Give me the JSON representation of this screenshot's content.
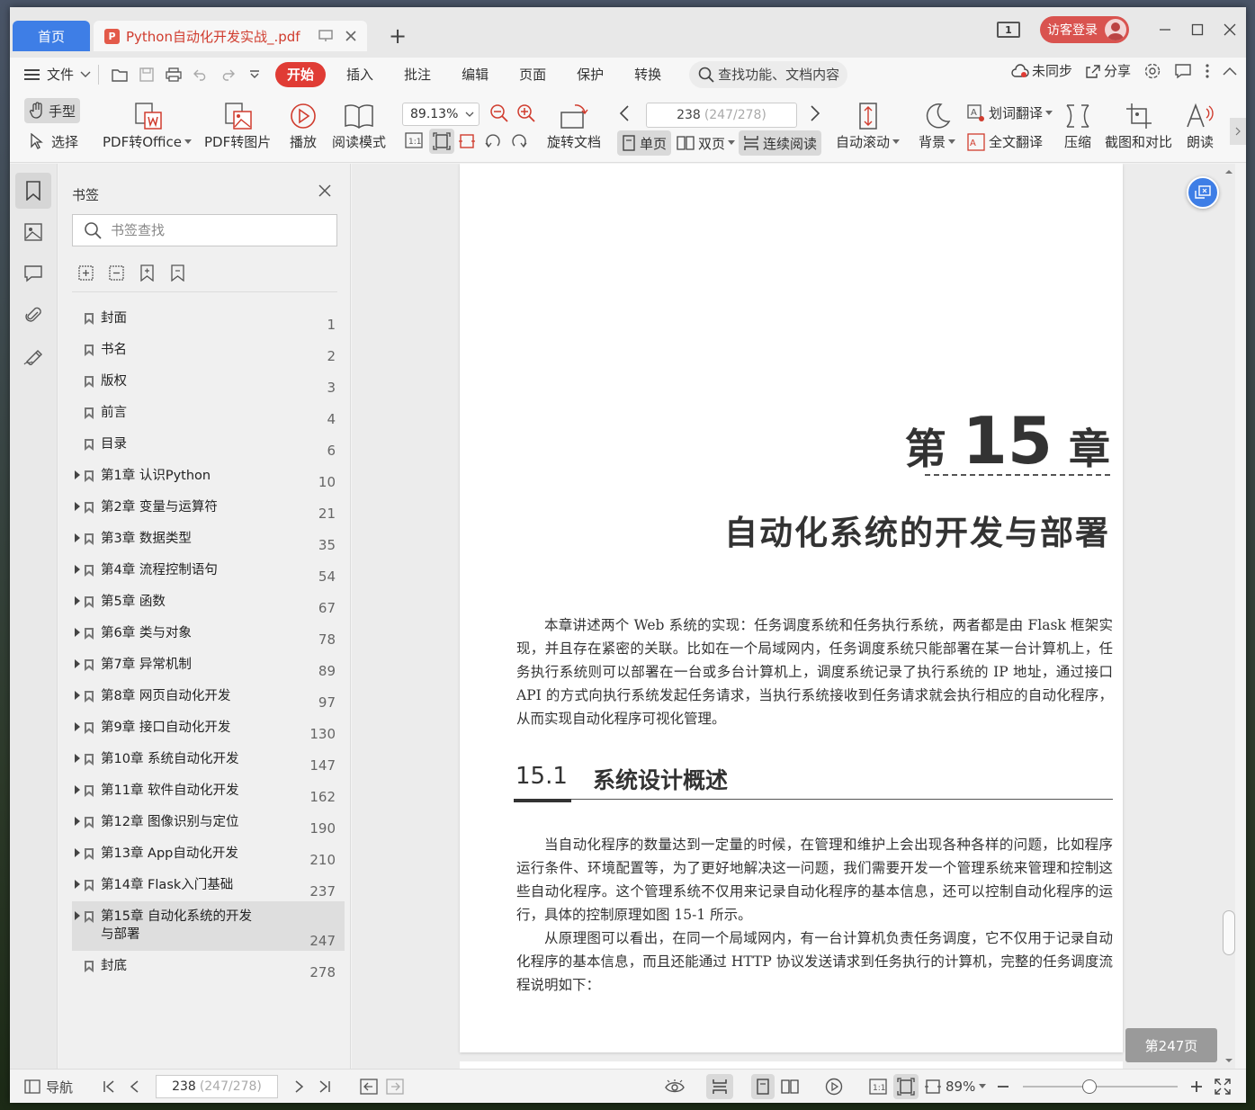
{
  "titlebar": {
    "home_tab": "首页",
    "doc_tab": "Python自动化开发实战_.pdf",
    "pdf_badge": "P",
    "page_count_badge": "1",
    "login": "访客登录"
  },
  "menubar": {
    "file": "文件",
    "tabs": [
      "开始",
      "插入",
      "批注",
      "编辑",
      "页面",
      "保护",
      "转换"
    ],
    "active_tab": "开始",
    "search": "查找功能、文档内容",
    "sync": "未同步",
    "share": "分享"
  },
  "toolbar": {
    "hand": "手型",
    "select": "选择",
    "pdf_to_office": "PDF转Office",
    "pdf_to_image": "PDF转图片",
    "play": "播放",
    "read_mode": "阅读模式",
    "zoom": "89.13%",
    "rotate_doc": "旋转文档",
    "page_current": "238",
    "page_info": "(247/278)",
    "single_page": "单页",
    "double_page": "双页",
    "continuous": "连续阅读",
    "auto_scroll": "自动滚动",
    "background": "背景",
    "word_translate": "划词翻译",
    "full_translate": "全文翻译",
    "compress": "压缩",
    "screenshot_compare": "截图和对比",
    "read_aloud": "朗读"
  },
  "bookmarks": {
    "title": "书签",
    "search_placeholder": "书签查找",
    "items": [
      {
        "label": "封面",
        "page": "1",
        "expandable": false
      },
      {
        "label": "书名",
        "page": "2",
        "expandable": false
      },
      {
        "label": "版权",
        "page": "3",
        "expandable": false
      },
      {
        "label": "前言",
        "page": "4",
        "expandable": false
      },
      {
        "label": "目录",
        "page": "6",
        "expandable": false
      },
      {
        "label": "第1章 认识Python",
        "page": "10",
        "expandable": true
      },
      {
        "label": "第2章 变量与运算符",
        "page": "21",
        "expandable": true
      },
      {
        "label": "第3章 数据类型",
        "page": "35",
        "expandable": true
      },
      {
        "label": "第4章 流程控制语句",
        "page": "54",
        "expandable": true
      },
      {
        "label": "第5章 函数",
        "page": "67",
        "expandable": true
      },
      {
        "label": "第6章 类与对象",
        "page": "78",
        "expandable": true
      },
      {
        "label": "第7章 异常机制",
        "page": "89",
        "expandable": true
      },
      {
        "label": "第8章 网页自动化开发",
        "page": "97",
        "expandable": true
      },
      {
        "label": "第9章 接口自动化开发",
        "page": "130",
        "expandable": true
      },
      {
        "label": "第10章 系统自动化开发",
        "page": "147",
        "expandable": true
      },
      {
        "label": "第11章 软件自动化开发",
        "page": "162",
        "expandable": true
      },
      {
        "label": "第12章 图像识别与定位",
        "page": "190",
        "expandable": true
      },
      {
        "label": "第13章 App自动化开发",
        "page": "210",
        "expandable": true
      },
      {
        "label": "第14章 Flask入门基础",
        "page": "237",
        "expandable": true
      },
      {
        "label": "第15章 自动化系统的开发与部署",
        "page": "247",
        "expandable": true,
        "selected": true
      },
      {
        "label": "封底",
        "page": "278",
        "expandable": false
      }
    ]
  },
  "document": {
    "chapter_prefix": "第",
    "chapter_number": "15",
    "chapter_suffix": "章",
    "chapter_title": "自动化系统的开发与部署",
    "intro": "本章讲述两个 Web 系统的实现：任务调度系统和任务执行系统，两者都是由 Flask 框架实现，并且存在紧密的关联。比如在一个局域网内，任务调度系统只能部署在某一台计算机上，任务执行系统则可以部署在一台或多台计算机上，调度系统记录了执行系统的 IP 地址，通过接口 API 的方式向执行系统发起任务请求，当执行系统接收到任务请求就会执行相应的自动化程序，从而实现自动化程序可视化管理。",
    "section_number": "15.1",
    "section_title": "系统设计概述",
    "para1": "当自动化程序的数量达到一定量的时候，在管理和维护上会出现各种各样的问题，比如程序运行条件、环境配置等，为了更好地解决这一问题，我们需要开发一个管理系统来管理和控制这些自动化程序。这个管理系统不仅用来记录自动化程序的基本信息，还可以控制自动化程序的运行，具体的控制原理如图 15-1 所示。",
    "para2": "从原理图可以看出，在同一个局域网内，有一台计算机负责任务调度，它不仅用于记录自动化程序的基本信息，而且还能通过 HTTP 协议发送请求到任务执行的计算机，完整的任务调度流程说明如下：",
    "page_tip": "第247页"
  },
  "statusbar": {
    "nav": "导航",
    "page_current": "238",
    "page_info": "(247/278)",
    "zoom": "89%"
  },
  "colors": {
    "accent_blue": "#3e7ee6",
    "active_red": "#e03c35",
    "login_red": "#d9534f"
  }
}
